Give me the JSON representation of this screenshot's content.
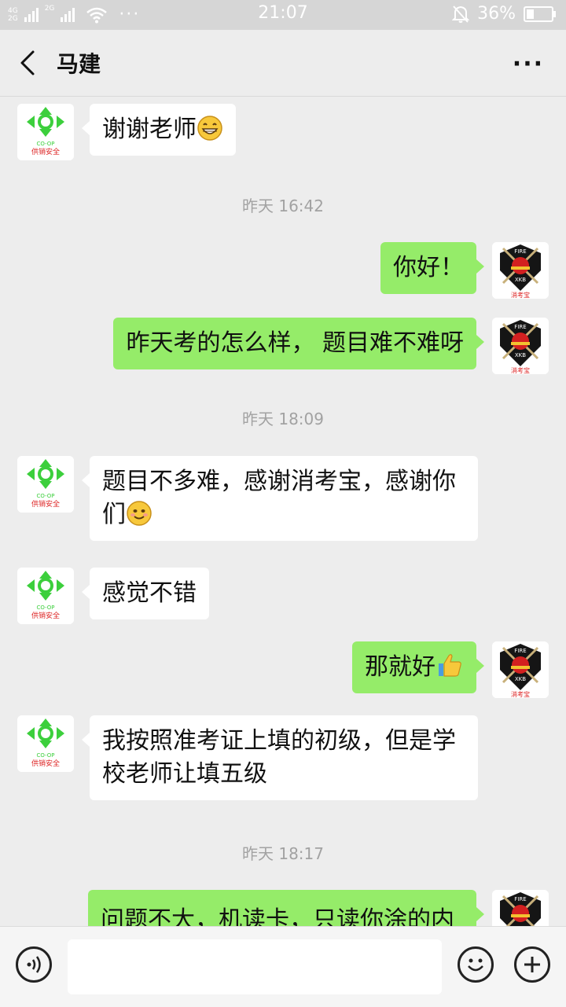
{
  "status_bar": {
    "network_top": "4G",
    "network_bottom": "2G",
    "network_2": "2G",
    "more_dots": "···",
    "time": "21:07",
    "battery": "36%",
    "battery_level": 0.36
  },
  "header": {
    "title": "马建",
    "more_label": "···"
  },
  "messages": [
    {
      "side": "left",
      "text": "谢谢老师",
      "emoji": "grin-emoji"
    },
    {
      "type": "timestamp",
      "text": "昨天 16:42"
    },
    {
      "side": "right",
      "text": "你好！"
    },
    {
      "side": "right",
      "text": "昨天考的怎么样， 题目难不难呀"
    },
    {
      "type": "timestamp",
      "text": "昨天 18:09"
    },
    {
      "side": "left",
      "line1": "题目不多难，感谢消考宝，感谢你",
      "line2": "们",
      "emoji": "smile-emoji"
    },
    {
      "side": "left",
      "text": "感觉不错"
    },
    {
      "side": "right",
      "text": "那就好",
      "emoji": "thumbs-up-emoji"
    },
    {
      "side": "left",
      "line1": "我按照准考证上填的初级，但是学",
      "line2": "校老师让填五级"
    },
    {
      "type": "timestamp",
      "text": "昨天 18:17"
    },
    {
      "side": "right",
      "text": "问题不大，机读卡，只读你涂的内"
    }
  ],
  "avatars": {
    "left_caption": "供销安全",
    "left_co_op": "CO-OP",
    "right_fire": "FIRE",
    "right_xkb": "XKB",
    "right_caption": "消考宝"
  },
  "input_bar": {
    "placeholder": "",
    "value": ""
  },
  "colors": {
    "bubble_sent": "#95ec69",
    "bubble_received": "#ffffff",
    "background": "#ededed"
  }
}
